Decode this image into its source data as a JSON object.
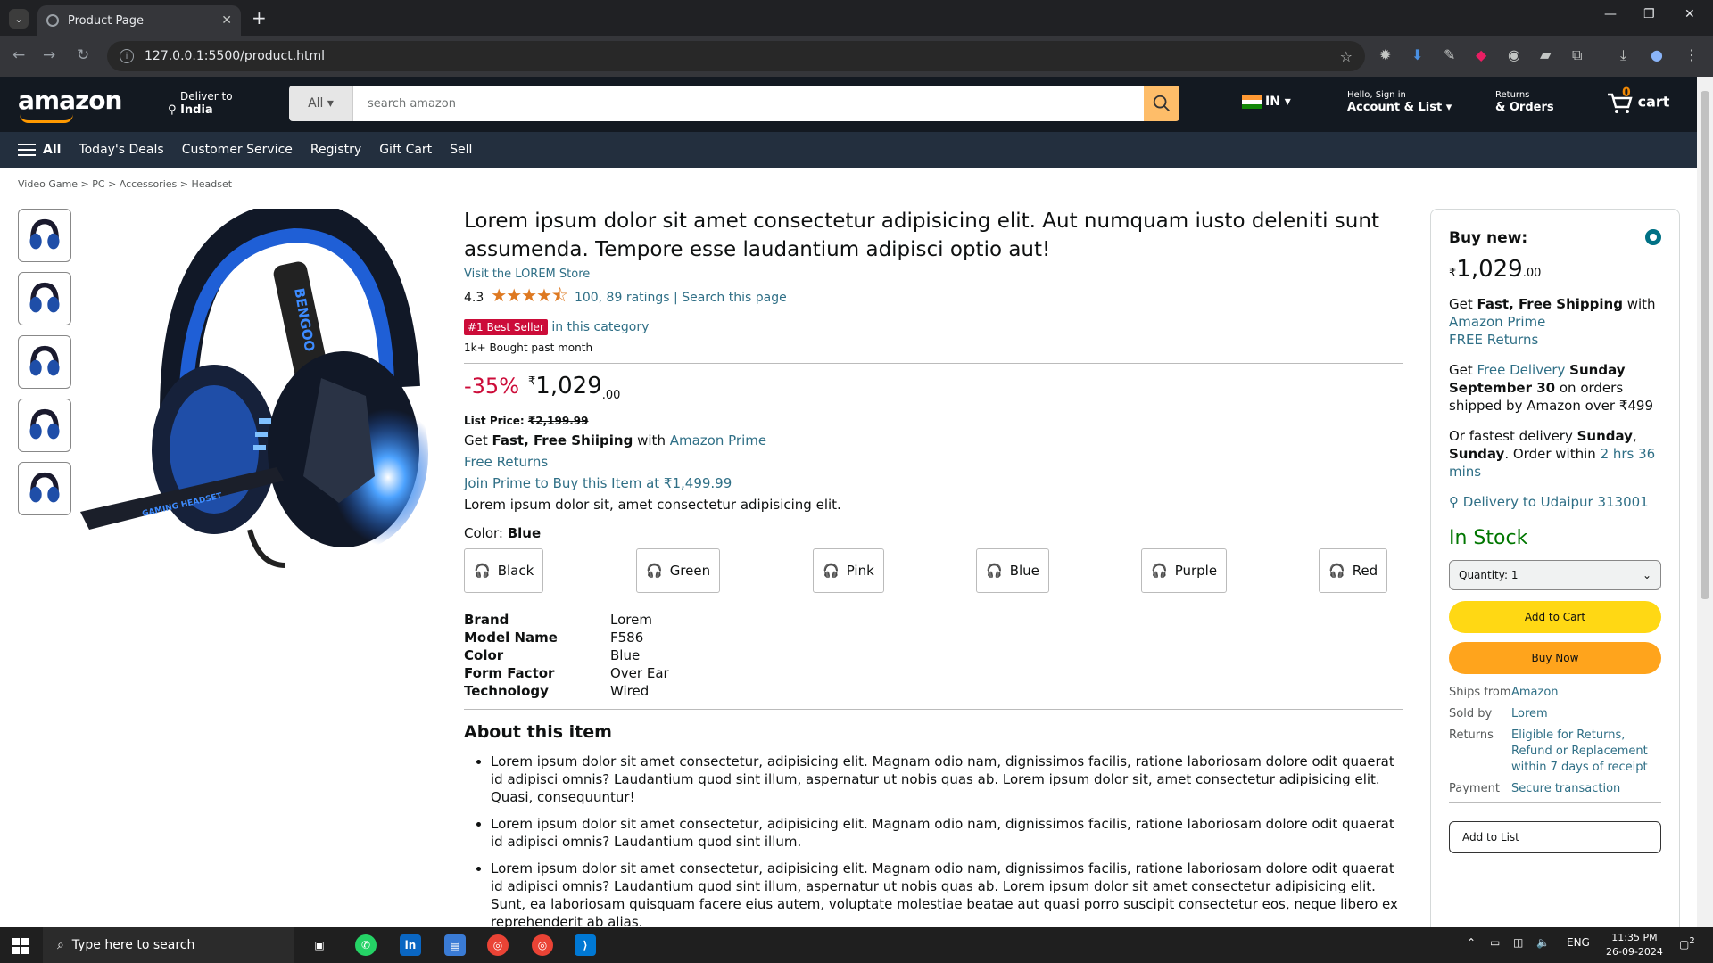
{
  "browser": {
    "tab_title": "Product Page",
    "url": "127.0.0.1:5500/product.html"
  },
  "header": {
    "logo": "amazon",
    "deliver_line1": "Deliver to",
    "deliver_line2": "India",
    "search_category": "All",
    "search_placeholder": "search amazon",
    "lang": "IN",
    "account_line1": "Hello, Sign in",
    "account_line2": "Account & List",
    "orders_line1": "Returns",
    "orders_line2": "& Orders",
    "cart_count": "0",
    "cart_label": "cart"
  },
  "subnav": {
    "all": "All",
    "items": [
      "Today's Deals",
      "Customer Service",
      "Registry",
      "Gift Cart",
      "Sell"
    ]
  },
  "breadcrumb": "Video Game > PC > Accessories > Headset",
  "product": {
    "title": "Lorem ipsum dolor sit amet consectetur adipisicing elit. Aut numquam iusto deleniti sunt assumenda. Tempore esse laudantium adipisci optio aut!",
    "store": "Visit the LOREM Store",
    "rating_value": "4.3",
    "stars": "★★★★⯪",
    "ratings_link": "100, 89 ratings | Search this page",
    "badge": "#1 Best Seller",
    "badge_suffix": "in this category",
    "bought": "1k+ Bought past month",
    "discount": "-35%",
    "currency": "₹",
    "price_main": "1,029",
    "price_frac": ".00",
    "list_price_label": "List Price:",
    "list_price": "₹2,199.99",
    "shipping_pre": "Get",
    "shipping_bold": "Fast, Free Shiiping",
    "shipping_with": "with",
    "shipping_link": "Amazon Prime",
    "free_returns": "Free Returns",
    "join_prime": "Join Prime to Buy this Item at ₹1,499.99",
    "desc": "Lorem ipsum dolor sit, amet consectetur adipisicing elit.",
    "color_label": "Color:",
    "color_value": "Blue",
    "colors": [
      "Black",
      "Green",
      "Pink",
      "Blue",
      "Purple",
      "Red"
    ],
    "specs": [
      {
        "k": "Brand",
        "v": "Lorem"
      },
      {
        "k": "Model Name",
        "v": "F586"
      },
      {
        "k": "Color",
        "v": "Blue"
      },
      {
        "k": "Form Factor",
        "v": "Over Ear"
      },
      {
        "k": "Technology",
        "v": "Wired"
      }
    ],
    "about_title": "About this item",
    "bullets": [
      "Lorem ipsum dolor sit amet consectetur, adipisicing elit. Magnam odio nam, dignissimos facilis, ratione laboriosam dolore odit quaerat id adipisci omnis? Laudantium quod sint illum, aspernatur ut nobis quas ab. Lorem ipsum dolor sit, amet consectetur adipisicing elit. Quasi, consequuntur!",
      "Lorem ipsum dolor sit amet consectetur, adipisicing elit. Magnam odio nam, dignissimos facilis, ratione laboriosam dolore odit quaerat id adipisci omnis? Laudantium quod sint illum.",
      "Lorem ipsum dolor sit amet consectetur, adipisicing elit. Magnam odio nam, dignissimos facilis, ratione laboriosam dolore odit quaerat id adipisci omnis? Laudantium quod sint illum, aspernatur ut nobis quas ab. Lorem ipsum dolor sit amet consectetur adipisicing elit. Sunt, ea laboriosam quisquam facere eius autem, voluptate molestiae beatae aut quasi porro suscipit consectetur eos, neque libero ex reprehenderit ab alias."
    ],
    "image_label": "BENGOO",
    "image_sublabel": "GAMING HEADSET"
  },
  "buybox": {
    "title": "Buy new:",
    "currency": "₹",
    "price_main": "1,029",
    "price_frac": ".00",
    "ship_pre": "Get",
    "ship_bold": "Fast, Free Shipping",
    "ship_with": "with",
    "ship_link1": "Amazon Prime",
    "ship_link2": "FREE Returns",
    "del_pre": "Get",
    "del_link": "Free Delivery",
    "del_bold": "Sunday September 30",
    "del_post": "on orders shipped by Amazon over ₹499",
    "fast_pre": "Or fastest delivery",
    "fast_bold1": "Sunday",
    "fast_bold2": "Sunday",
    "fast_mid": ". Order within",
    "fast_link": "2 hrs 36 mins",
    "location": "Delivery to Udaipur 313001",
    "stock": "In Stock",
    "quantity": "Quantity: 1",
    "add_to_cart": "Add to Cart",
    "buy_now": "Buy Now",
    "ships_from_k": "Ships from",
    "ships_from_v": "Amazon",
    "sold_by_k": "Sold by",
    "sold_by_v": "Lorem",
    "returns_k": "Returns",
    "returns_v": "Eligible for Returns, Refund or Replacement within 7 days of receipt",
    "payment_k": "Payment",
    "payment_v": "Secure transaction",
    "add_to_list": "Add to List"
  },
  "taskbar": {
    "search_placeholder": "Type here to search",
    "lang": "ENG",
    "time": "11:35 PM",
    "date": "26-09-2024",
    "notif_count": "2"
  },
  "colors": {
    "amazon_dark": "#131921",
    "amazon_nav": "#232f3e",
    "accent_orange": "#ff9900",
    "link": "#2f6f86",
    "best_seller": "#cc0c39",
    "in_stock": "#007600"
  }
}
